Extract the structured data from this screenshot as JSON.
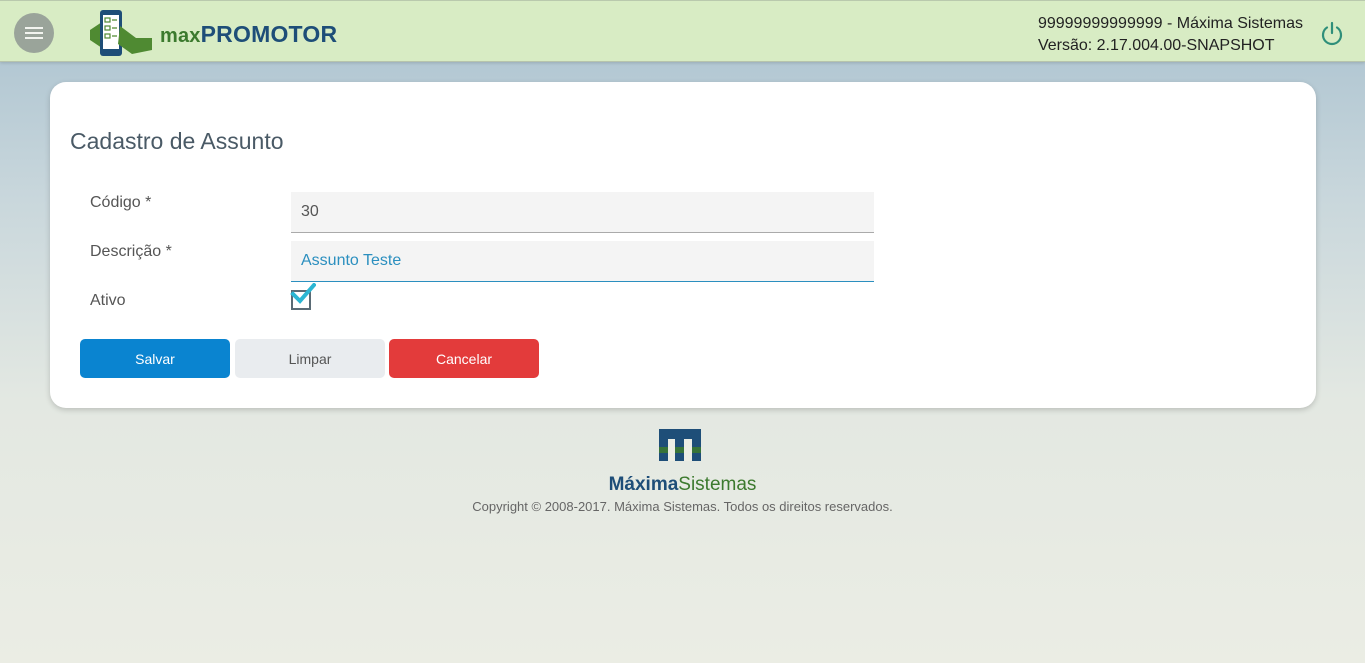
{
  "header": {
    "brand_prefix": "max",
    "brand_name": "PROMOTOR",
    "user_line": "99999999999999 - Máxima Sistemas",
    "version_line": "Versão: 2.17.004.00-SNAPSHOT"
  },
  "form": {
    "title": "Cadastro de Assunto",
    "codigo_label": "Código *",
    "codigo_value": "30",
    "descricao_label": "Descrição *",
    "descricao_value": "Assunto Teste",
    "ativo_label": "Ativo",
    "ativo_checked": true
  },
  "buttons": {
    "save": "Salvar",
    "clear": "Limpar",
    "cancel": "Cancelar"
  },
  "footer": {
    "brand_bold": "Máxima",
    "brand_light": "Sistemas",
    "copyright": "Copyright © 2008-2017. Máxima Sistemas. Todos os direitos reservados."
  },
  "colors": {
    "header_bg": "#d8ecc4",
    "primary": "#0a84d0",
    "danger": "#e33b3b",
    "check": "#2bb6d3"
  },
  "icons": [
    "menu-icon",
    "app-logo-icon",
    "power-icon",
    "check-icon",
    "maxima-logo-icon"
  ]
}
